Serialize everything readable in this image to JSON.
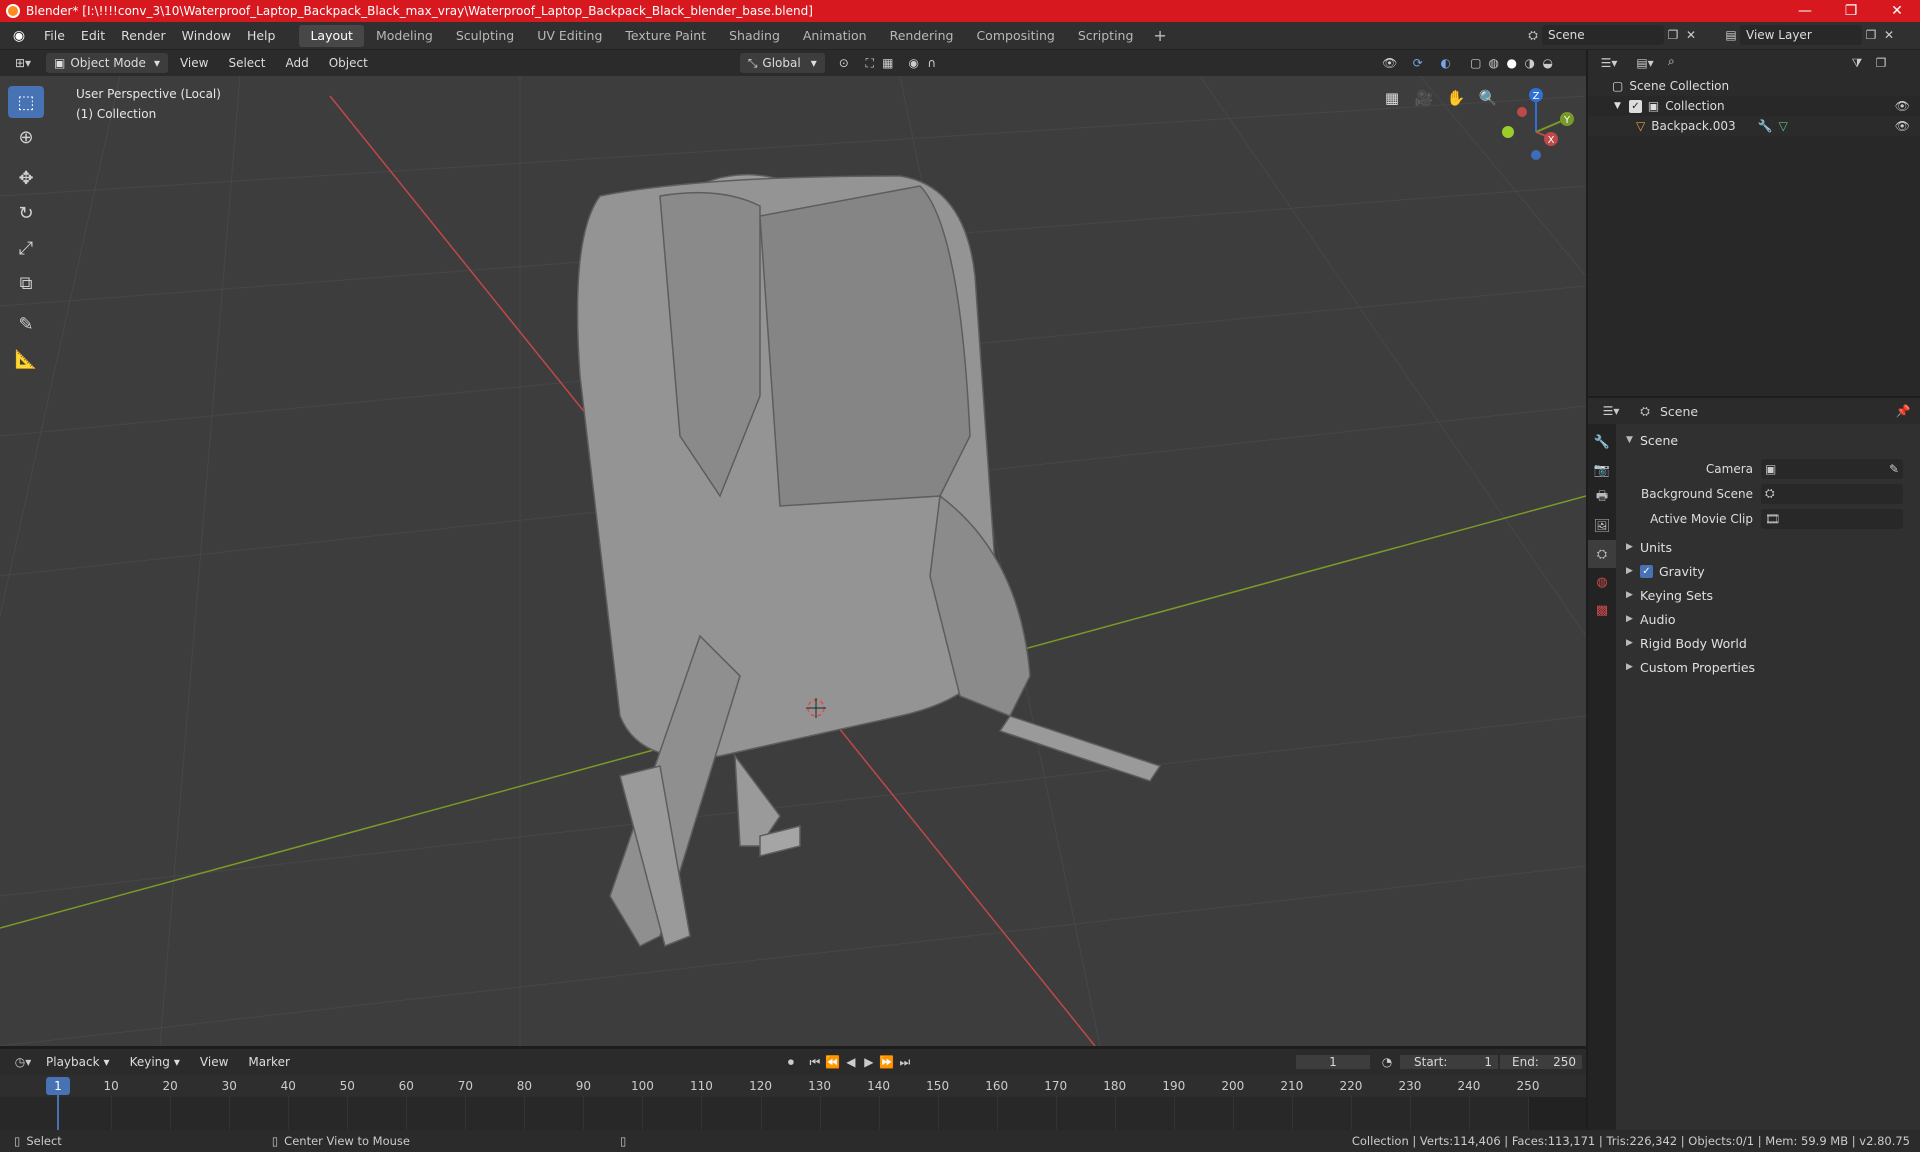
{
  "window": {
    "title": "Blender* [I:\\!!!!conv_3\\10\\Waterproof_Laptop_Backpack_Black_max_vray\\Waterproof_Laptop_Backpack_Black_blender_base.blend]",
    "controls": [
      "—",
      "❐",
      "✕"
    ]
  },
  "menu": [
    "File",
    "Edit",
    "Render",
    "Window",
    "Help"
  ],
  "workspaces": [
    "Layout",
    "Modeling",
    "Sculpting",
    "UV Editing",
    "Texture Paint",
    "Shading",
    "Animation",
    "Rendering",
    "Compositing",
    "Scripting"
  ],
  "active_workspace": "Layout",
  "scene_field": "Scene",
  "view_layer_field": "View Layer",
  "viewport_header": {
    "mode": "Object Mode",
    "menus": [
      "View",
      "Select",
      "Add",
      "Object"
    ],
    "orientation": "Global"
  },
  "viewport": {
    "perspective_label": "User Perspective (Local)",
    "collection_label": "(1) Collection",
    "gizmo_axes": [
      "Z",
      "Y",
      "X"
    ],
    "colors": {
      "x_axis": "#c04848",
      "y_axis": "#7a9a28",
      "z_axis": "#2f6fd6",
      "active_tool": "#4772b3"
    }
  },
  "tools": [
    "select-box",
    "cursor",
    "move",
    "rotate",
    "scale",
    "transform",
    "annotate",
    "measure"
  ],
  "outliner": {
    "root": "Scene Collection",
    "items": [
      {
        "label": "Collection"
      },
      {
        "label": "Backpack.003"
      }
    ]
  },
  "properties": {
    "header": "Scene",
    "section": "Scene",
    "fields": [
      {
        "label": "Camera"
      },
      {
        "label": "Background Scene"
      },
      {
        "label": "Active Movie Clip"
      }
    ],
    "panels": [
      "Units",
      "Gravity",
      "Keying Sets",
      "Audio",
      "Rigid Body World",
      "Custom Properties"
    ]
  },
  "timeline": {
    "menus": [
      "Playback",
      "Keying",
      "View",
      "Marker"
    ],
    "current_frame": "1",
    "start_label": "Start:",
    "start": "1",
    "end_label": "End:",
    "end": "250",
    "ticks": [
      "10",
      "20",
      "30",
      "40",
      "50",
      "60",
      "70",
      "80",
      "90",
      "100",
      "110",
      "120",
      "130",
      "140",
      "150",
      "160",
      "170",
      "180",
      "190",
      "200",
      "210",
      "220",
      "230",
      "240",
      "250"
    ]
  },
  "statusbar": {
    "left": "Select",
    "middle": "Center View to Mouse",
    "stats": "Collection | Verts:114,406 | Faces:113,171 | Tris:226,342 | Objects:0/1 | Mem: 59.9 MB | v2.80.75"
  }
}
